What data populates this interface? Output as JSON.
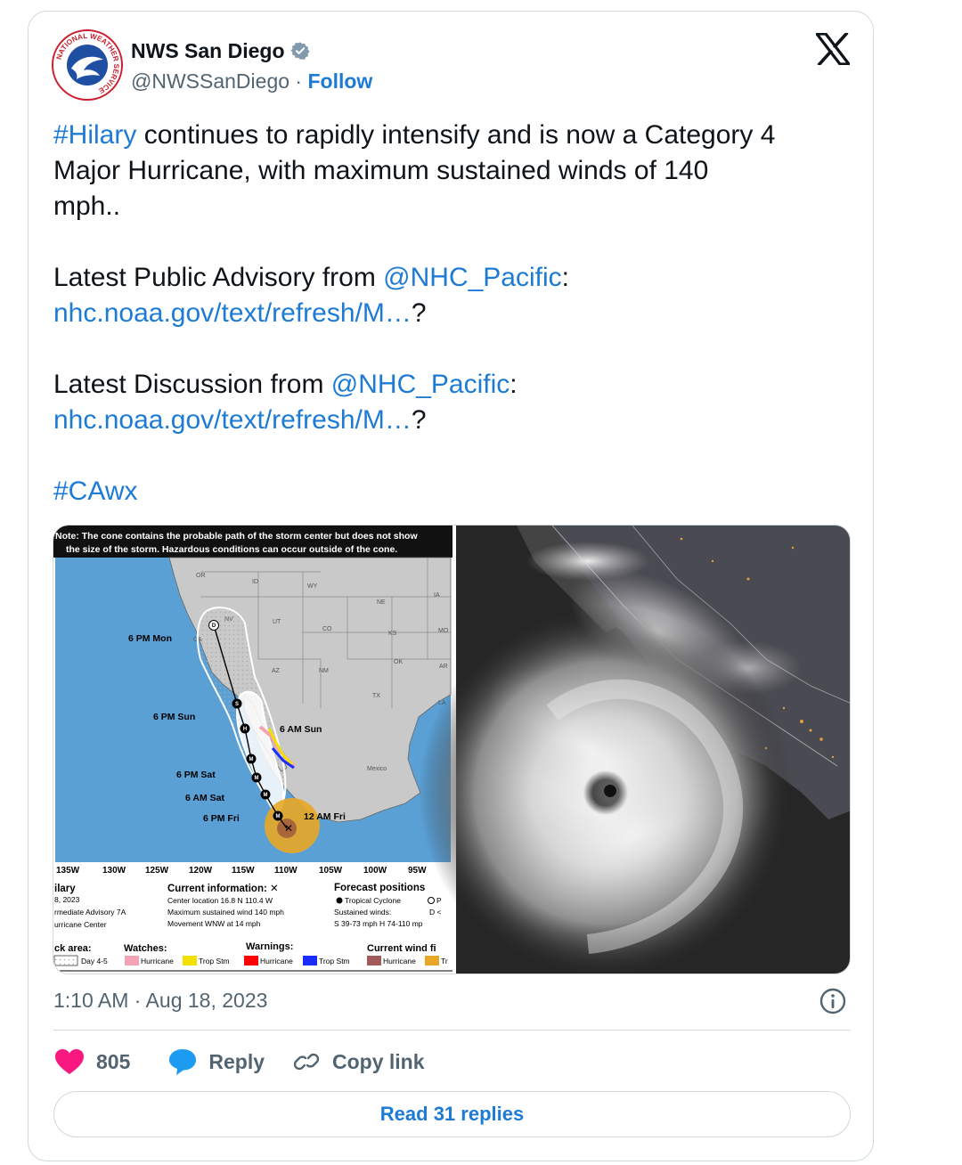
{
  "account": {
    "name": "NWS San Diego",
    "handle": "@NWSSanDiego",
    "separator": " · ",
    "follow_label": "Follow",
    "logo_ring_text": "NATIONAL WEATHER SERVICE"
  },
  "tweet": {
    "lines": [
      {
        "segments": [
          {
            "text": "#Hilary",
            "link": true
          },
          {
            "text": " continues to rapidly intensify and is now a Category 4",
            "link": false
          }
        ]
      },
      {
        "segments": [
          {
            "text": "Major Hurricane, with maximum sustained winds of 140",
            "link": false
          }
        ]
      },
      {
        "segments": [
          {
            "text": "mph..",
            "link": false
          }
        ]
      },
      {
        "gap": true
      },
      {
        "segments": [
          {
            "text": "Latest Public Advisory from ",
            "link": false
          },
          {
            "text": "@NHC_Pacific",
            "link": true
          },
          {
            "text": ":",
            "link": false
          }
        ]
      },
      {
        "segments": [
          {
            "text": "nhc.noaa.gov/text/refresh/M…",
            "link": true
          },
          {
            "text": "?",
            "link": false
          }
        ]
      },
      {
        "gap": true
      },
      {
        "segments": [
          {
            "text": "Latest Discussion from ",
            "link": false
          },
          {
            "text": "@NHC_Pacific",
            "link": true
          },
          {
            "text": ":",
            "link": false
          }
        ]
      },
      {
        "segments": [
          {
            "text": "nhc.noaa.gov/text/refresh/M…",
            "link": true
          },
          {
            "text": "?",
            "link": false
          }
        ]
      },
      {
        "gap": true
      },
      {
        "segments": [
          {
            "text": "#CAwx",
            "link": true
          }
        ]
      }
    ]
  },
  "media": {
    "cone_map": {
      "note_line1": "Note: The cone contains the probable path of the storm center but does not show",
      "note_line2": "the size of the storm. Hazardous conditions can occur outside of the cone.",
      "states": [
        "OR",
        "ID",
        "WY",
        "NV",
        "UT",
        "CO",
        "NE",
        "KS",
        "IA",
        "MO",
        "AZ",
        "NM",
        "OK",
        "AR",
        "TX",
        "LA",
        "CA",
        "Mexico"
      ],
      "forecast_labels": [
        "6 PM Mon",
        "6 PM Sun",
        "6 AM Sun",
        "6 PM Sat",
        "6 AM Sat",
        "6 PM Fri",
        "12 AM Fri"
      ],
      "longitudes": [
        "135W",
        "130W",
        "125W",
        "120W",
        "115W",
        "110W",
        "105W",
        "100W",
        "95W"
      ],
      "legend": {
        "storm_name": "ilary",
        "date": "8, 2023",
        "advisory": "rmediate Advisory 7A",
        "center": "urricane Center",
        "current_info_title": "Current information: ✕",
        "current_info_lines": [
          "Center location 16.8 N 110.4 W",
          "Maximum sustained wind 140 mph",
          "Movement WNW at 14 mph"
        ],
        "forecast_title": "Forecast positions",
        "forecast_lines": [
          "Tropical Cyclone",
          "Sustained winds:",
          "S 39-73 mph  H 74-110 mp"
        ],
        "forecast_extra": [
          "P",
          "D <"
        ],
        "track_area": "ck area:",
        "track_day": "Day 4-5",
        "watches_title": "Watches:",
        "watches_items": [
          "Hurricane",
          "Trop Stm"
        ],
        "warnings_title": "Warnings:",
        "warnings_items": [
          "Hurricane",
          "Trop Stm"
        ],
        "wind_title": "Current wind fi",
        "wind_items": [
          "Hurricane",
          "Tr"
        ]
      }
    }
  },
  "timestamp": "1:10 AM · Aug 18, 2023",
  "actions": {
    "likes": "805",
    "reply_label": "Reply",
    "copy_label": "Copy link"
  },
  "read_replies": "Read 31 replies",
  "colors": {
    "link": "#1d7bd6",
    "heart": "#f91880",
    "text": "#0f1419",
    "muted": "#536471",
    "border": "#cfd9de"
  }
}
